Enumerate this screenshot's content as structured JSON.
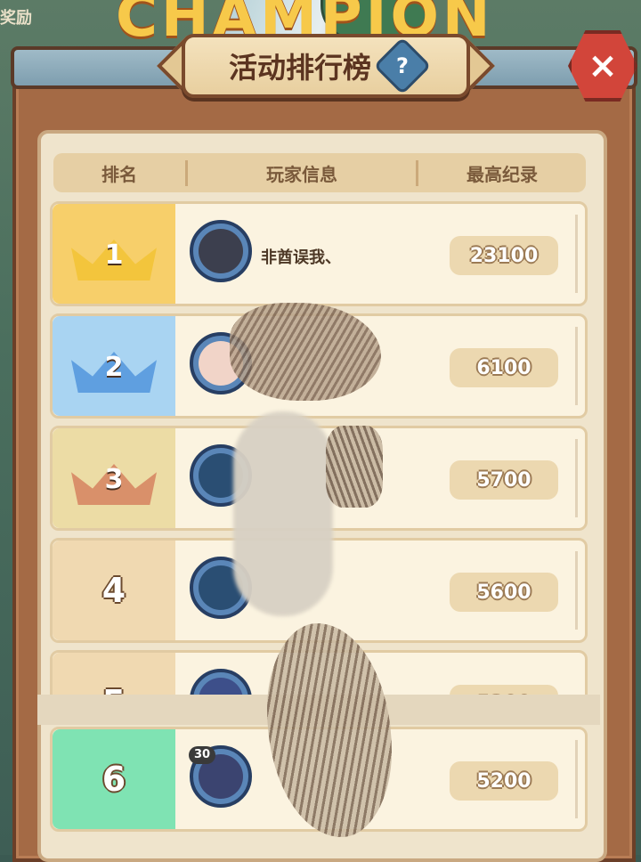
{
  "background": {
    "corner_text": "奖励",
    "banner_text": "CHAMPION"
  },
  "title": {
    "text": "活动排行榜",
    "help_icon": "?"
  },
  "close": {
    "icon": "×"
  },
  "header": {
    "rank": "排名",
    "player": "玩家信息",
    "record": "最高纪录"
  },
  "rows": [
    {
      "rank": "1",
      "name": "非酋误我、",
      "score": "23100",
      "rank_bg": "#f7cf6a",
      "crown_color": "#f3c53c"
    },
    {
      "rank": "2",
      "name": "",
      "score": "6100",
      "rank_bg": "#a9d4f2",
      "crown_color": "#5f9fe0"
    },
    {
      "rank": "3",
      "name": "",
      "score": "5700",
      "rank_bg": "#ecdca5",
      "crown_color": "#d9906a"
    },
    {
      "rank": "4",
      "name": "",
      "score": "5600",
      "rank_bg": "#f0d9b1"
    },
    {
      "rank": "5",
      "name": "",
      "score": "5300",
      "rank_bg": "#f0d9b1"
    }
  ],
  "my_row": {
    "rank": "6",
    "name": "",
    "score": "5200",
    "level": "30",
    "rank_bg": "#7fe3b3"
  }
}
